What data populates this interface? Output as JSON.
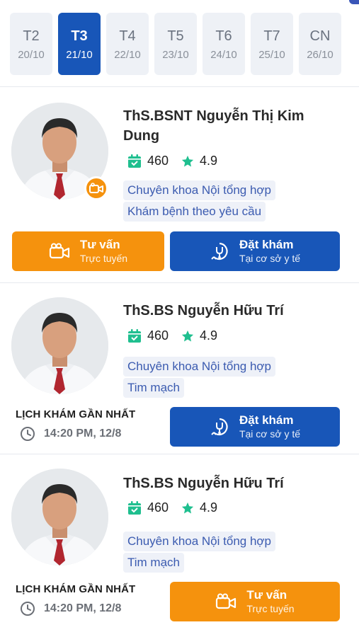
{
  "days": [
    {
      "weekday": "T2",
      "date": "20/10",
      "active": false
    },
    {
      "weekday": "T3",
      "date": "21/10",
      "active": true
    },
    {
      "weekday": "T4",
      "date": "22/10",
      "active": false
    },
    {
      "weekday": "T5",
      "date": "23/10",
      "active": false
    },
    {
      "weekday": "T6",
      "date": "24/10",
      "active": false
    },
    {
      "weekday": "T7",
      "date": "25/10",
      "active": false
    },
    {
      "weekday": "CN",
      "date": "26/10",
      "active": false
    }
  ],
  "doctors": [
    {
      "name": "ThS.BSNT Nguyễn Thị Kim Dung",
      "count": "460",
      "rating": "4.9",
      "tags": [
        "Chuyên khoa Nội tổng hợp",
        "Khám bệnh theo yêu cầu"
      ],
      "online_button": {
        "title": "Tư vấn",
        "subtitle": "Trực tuyến"
      },
      "book_button": {
        "title": "Đặt khám",
        "subtitle": "Tại cơ sở y tế"
      }
    },
    {
      "name": "ThS.BS Nguyễn Hữu Trí",
      "count": "460",
      "rating": "4.9",
      "tags": [
        "Chuyên khoa Nội tổng hợp",
        "Tim mạch"
      ],
      "schedule_label": "LỊCH KHÁM GẦN NHẤT",
      "schedule_time": "14:20 PM, 12/8",
      "book_button": {
        "title": "Đặt khám",
        "subtitle": "Tại cơ sở y tế"
      }
    },
    {
      "name": "ThS.BS Nguyễn Hữu Trí",
      "count": "460",
      "rating": "4.9",
      "tags": [
        "Chuyên khoa Nội tổng hợp",
        "Tim mạch"
      ],
      "schedule_label": "LỊCH KHÁM GẦN NHẤT",
      "schedule_time": "14:20 PM, 12/8",
      "online_button": {
        "title": "Tư vấn",
        "subtitle": "Trực tuyến"
      }
    }
  ],
  "colors": {
    "primary_blue": "#1856b8",
    "accent_orange": "#f5920d",
    "stat_green": "#1fbf8f",
    "tag_text": "#3b5bb0"
  }
}
